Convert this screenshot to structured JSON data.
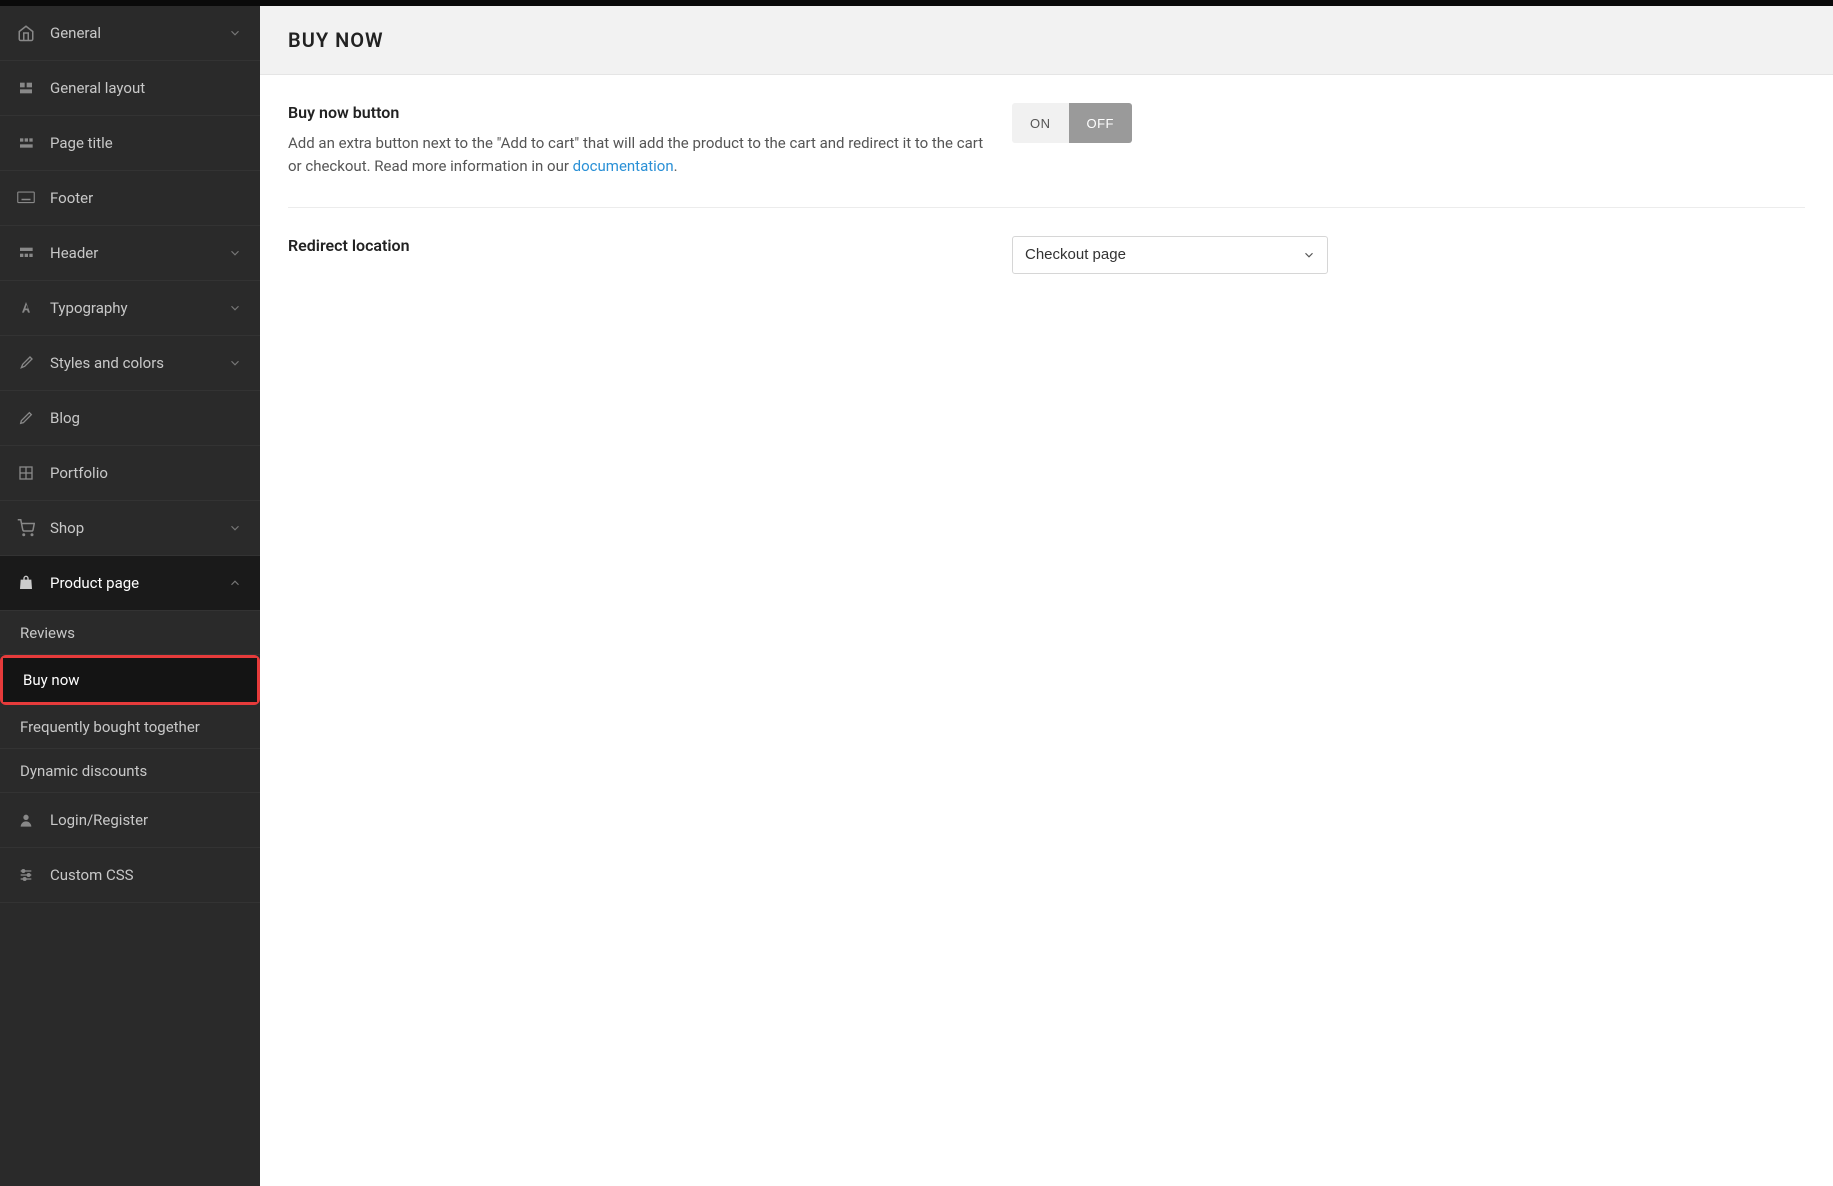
{
  "sidebar": {
    "items": [
      {
        "id": "general",
        "label": "General",
        "icon": "home",
        "chevron": true
      },
      {
        "id": "general-layout",
        "label": "General layout",
        "icon": "layout"
      },
      {
        "id": "page-title",
        "label": "Page title",
        "icon": "grid-row"
      },
      {
        "id": "footer",
        "label": "Footer",
        "icon": "keyboard"
      },
      {
        "id": "header",
        "label": "Header",
        "icon": "grid-row",
        "chevron": true
      },
      {
        "id": "typography",
        "label": "Typography",
        "icon": "type",
        "chevron": true
      },
      {
        "id": "styles",
        "label": "Styles and colors",
        "icon": "brush",
        "chevron": true
      },
      {
        "id": "blog",
        "label": "Blog",
        "icon": "pencil"
      },
      {
        "id": "portfolio",
        "label": "Portfolio",
        "icon": "grid"
      },
      {
        "id": "shop",
        "label": "Shop",
        "icon": "cart",
        "chevron": true
      },
      {
        "id": "product-page",
        "label": "Product page",
        "icon": "bag",
        "chevron": true,
        "active": true,
        "open": true
      },
      {
        "id": "login",
        "label": "Login/Register",
        "icon": "user"
      },
      {
        "id": "custom-css",
        "label": "Custom CSS",
        "icon": "sliders"
      }
    ],
    "productSub": [
      {
        "id": "reviews",
        "label": "Reviews"
      },
      {
        "id": "buy-now",
        "label": "Buy now",
        "active": true,
        "highlighted": true
      },
      {
        "id": "fbt",
        "label": "Frequently bought together"
      },
      {
        "id": "dynamic-discounts",
        "label": "Dynamic discounts"
      }
    ]
  },
  "page": {
    "title": "BUY NOW",
    "settings": [
      {
        "id": "buy-now-button",
        "title": "Buy now button",
        "descPrefix": "Add an extra button next to the \"Add to cart\" that will add the product to the cart and redirect it to the cart or checkout. Read more information in our ",
        "linkText": "documentation",
        "descSuffix": ".",
        "control": "toggle",
        "on_label": "ON",
        "off_label": "OFF",
        "value": "off"
      },
      {
        "id": "redirect-location",
        "title": "Redirect location",
        "control": "select",
        "value": "Checkout page"
      }
    ]
  }
}
